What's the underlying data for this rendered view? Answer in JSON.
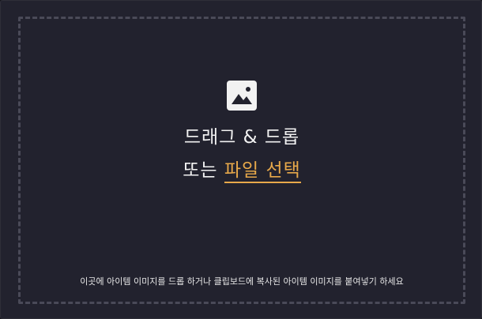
{
  "dropzone": {
    "icon": "image-icon",
    "title_line1": "드래그 & 드롭",
    "title_line2_prefix": "또는",
    "select_file_label": "파일 선택",
    "hint": "이곳에 아이템 이미지를 드롭 하거나 클립보드에 복사된 아이템 이미지를 붙여넣기 하세요"
  },
  "colors": {
    "background": "#22222e",
    "dashed_border": "#4a4a58",
    "text": "#f2f2f2",
    "accent": "#e8a94a"
  }
}
